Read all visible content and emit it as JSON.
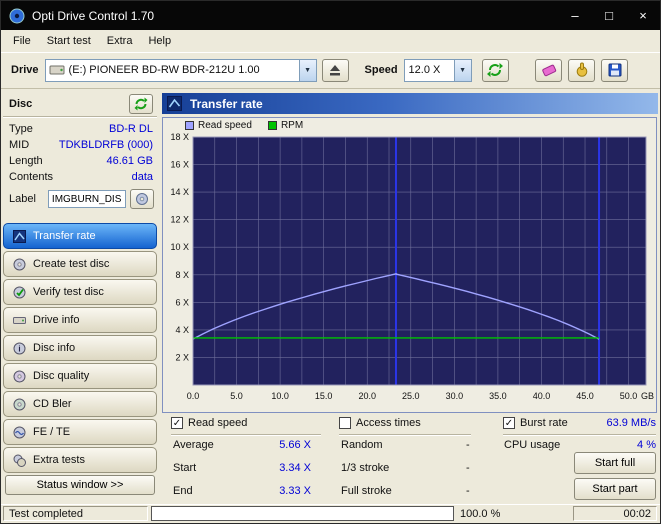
{
  "window": {
    "title": "Opti Drive Control 1.70"
  },
  "titlebar_buttons": {
    "minimize": "–",
    "maximize": "□",
    "close": "×"
  },
  "menu": {
    "items": [
      "File",
      "Start test",
      "Extra",
      "Help"
    ]
  },
  "toolbar": {
    "drive_label": "Drive",
    "drive_value": "(E:)  PIONEER BD-RW  BDR-212U 1.00",
    "speed_label": "Speed",
    "speed_value": "12.0 X"
  },
  "sidebar": {
    "disc_header": "Disc",
    "info": [
      {
        "label": "Type",
        "value": "BD-R DL"
      },
      {
        "label": "MID",
        "value": "TDKBLDRFB (000)"
      },
      {
        "label": "Length",
        "value": "46.61 GB"
      },
      {
        "label": "Contents",
        "value": "data"
      }
    ],
    "label_caption": "Label",
    "label_value": "IMGBURN_DIS",
    "nav": [
      {
        "label": "Transfer rate",
        "active": true
      },
      {
        "label": "Create test disc",
        "active": false
      },
      {
        "label": "Verify test disc",
        "active": false
      },
      {
        "label": "Drive info",
        "active": false
      },
      {
        "label": "Disc info",
        "active": false
      },
      {
        "label": "Disc quality",
        "active": false
      },
      {
        "label": "CD Bler",
        "active": false
      },
      {
        "label": "FE / TE",
        "active": false
      },
      {
        "label": "Extra tests",
        "active": false
      }
    ],
    "status_button": "Status window >>"
  },
  "main": {
    "header": "Transfer rate",
    "checkboxes": {
      "read_speed": {
        "label": "Read speed",
        "checked": true
      },
      "access_times": {
        "label": "Access times",
        "checked": false
      },
      "burst_rate": {
        "label": "Burst rate",
        "checked": true,
        "value": "63.9 MB/s"
      }
    },
    "stats": {
      "average_label": "Average",
      "average_value": "5.66 X",
      "start_label": "Start",
      "start_value": "3.34 X",
      "end_label": "End",
      "end_value": "3.33 X",
      "random_label": "Random",
      "random_value": "-",
      "third_stroke_label": "1/3 stroke",
      "third_stroke_value": "-",
      "full_stroke_label": "Full stroke",
      "full_stroke_value": "-",
      "cpu_label": "CPU usage",
      "cpu_value": "4 %"
    },
    "buttons": {
      "start_full": "Start full",
      "start_part": "Start part"
    }
  },
  "statusbar": {
    "text": "Test completed",
    "percent_label": "100.0 %",
    "progress_pct": 100,
    "time": "00:02"
  },
  "chart_data": {
    "type": "line",
    "title": "Transfer rate",
    "xlabel": "GB",
    "xlim": [
      0,
      52
    ],
    "ylim": [
      0,
      18
    ],
    "x_ticks": [
      0,
      5,
      10,
      15,
      20,
      25,
      30,
      35,
      40,
      45,
      50
    ],
    "x_minor_step": 2.5,
    "y_ticks": [
      2,
      4,
      6,
      8,
      10,
      12,
      14,
      16,
      18
    ],
    "y_suffix": " X",
    "grid": true,
    "legend_position": "top-left",
    "plot_bg": "#22225E",
    "grid_color": "#6E6E9A",
    "border_color": "#9898B8",
    "markers": [
      {
        "x": 23.3,
        "color": "#2B35E8"
      },
      {
        "x": 46.61,
        "color": "#2B35E8"
      }
    ],
    "series": [
      {
        "name": "Read speed",
        "color": "#9FA3FF",
        "points": [
          [
            0,
            3.34
          ],
          [
            1.17,
            3.72
          ],
          [
            2.33,
            4.07
          ],
          [
            3.5,
            4.39
          ],
          [
            4.66,
            4.69
          ],
          [
            5.83,
            4.97
          ],
          [
            6.99,
            5.23
          ],
          [
            8.16,
            5.48
          ],
          [
            9.32,
            5.72
          ],
          [
            10.49,
            5.96
          ],
          [
            11.65,
            6.18
          ],
          [
            12.82,
            6.39
          ],
          [
            13.98,
            6.6
          ],
          [
            15.15,
            6.8
          ],
          [
            16.31,
            7.0
          ],
          [
            17.48,
            7.19
          ],
          [
            18.64,
            7.37
          ],
          [
            19.81,
            7.55
          ],
          [
            20.97,
            7.73
          ],
          [
            22.14,
            7.9
          ],
          [
            23.3,
            8.07
          ],
          [
            23.31,
            8.05
          ],
          [
            24.47,
            7.88
          ],
          [
            25.64,
            7.71
          ],
          [
            26.8,
            7.53
          ],
          [
            27.97,
            7.35
          ],
          [
            29.13,
            7.17
          ],
          [
            30.3,
            6.98
          ],
          [
            31.46,
            6.79
          ],
          [
            32.63,
            6.58
          ],
          [
            33.79,
            6.38
          ],
          [
            34.96,
            6.16
          ],
          [
            36.12,
            5.94
          ],
          [
            37.29,
            5.71
          ],
          [
            38.45,
            5.47
          ],
          [
            39.62,
            5.22
          ],
          [
            40.78,
            4.96
          ],
          [
            41.95,
            4.68
          ],
          [
            43.11,
            4.38
          ],
          [
            44.28,
            4.06
          ],
          [
            45.44,
            3.71
          ],
          [
            46.61,
            3.33
          ]
        ]
      },
      {
        "name": "RPM",
        "color": "#00C400",
        "points": [
          [
            0,
            3.42
          ],
          [
            46.61,
            3.42
          ]
        ]
      }
    ]
  }
}
